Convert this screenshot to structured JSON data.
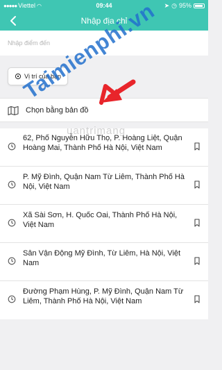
{
  "status_bar": {
    "carrier": "Viettel",
    "time": "09:44",
    "battery": "95%"
  },
  "header": {
    "title": "Nhập địa chỉ",
    "back_icon": "back-arrow-icon"
  },
  "search": {
    "placeholder": "Nhập điểm đến",
    "value": ""
  },
  "current_location": {
    "label": "Vị trí của bạn",
    "icon": "target-icon"
  },
  "map_option": {
    "label": "Chọn bằng bản đồ",
    "icon": "map-icon"
  },
  "recent_addresses": [
    {
      "text": "62, Phố Nguyễn Hữu Thọ, P. Hoàng Liệt, Quận Hoàng Mai, Thành Phố Hà Nội, Việt Nam"
    },
    {
      "text": "P. Mỹ Đình, Quận Nam Từ Liêm, Thành Phố Hà Nội, Việt Nam"
    },
    {
      "text": "Xã Sài Sơn, H. Quốc Oai, Thành Phố Hà Nội, Việt Nam"
    },
    {
      "text": "Sân Vận Động Mỹ Đình, Từ Liêm, Hà Nội, Việt Nam"
    },
    {
      "text": "Đường Phạm Hùng, P. Mỹ Đình, Quận Nam Từ Liêm, Thành Phố Hà Nội, Việt Nam"
    }
  ],
  "watermark": {
    "text": "Taimienphi.vn",
    "inline": "uantrimang"
  },
  "colors": {
    "brand": "#3fc6b3",
    "background": "#f0f0f2",
    "annotation_arrow": "#e8252b",
    "watermark": "#2270cc"
  }
}
